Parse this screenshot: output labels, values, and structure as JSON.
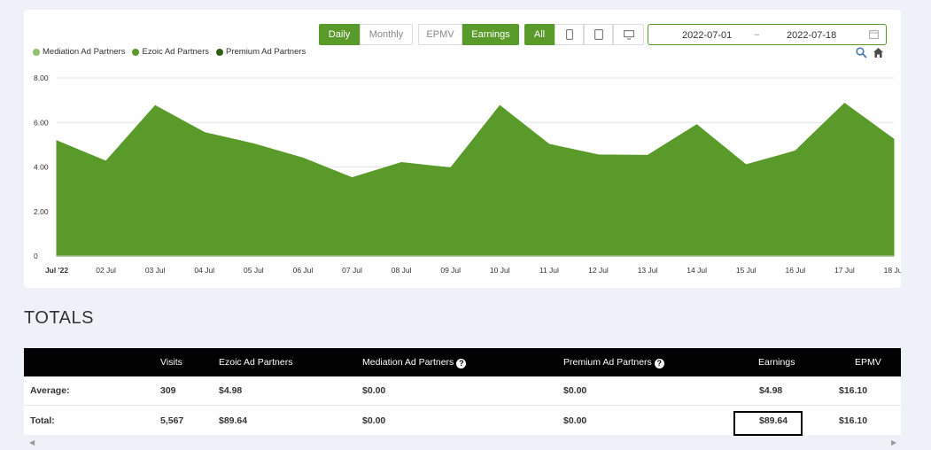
{
  "toolbar": {
    "period": [
      "Daily",
      "Monthly"
    ],
    "metric": [
      "EPMV",
      "Earnings"
    ],
    "device_all": "All"
  },
  "date_range": {
    "start": "2022-07-01",
    "separator": "~",
    "end": "2022-07-18"
  },
  "colors": {
    "accent": "#5a9a2b",
    "mediation": "#8dc26a",
    "ezoic": "#5a9a2b",
    "premium": "#2f5f14"
  },
  "chart_data": {
    "type": "area",
    "title": "",
    "xlabel": "",
    "ylabel": "",
    "legend": [
      "Mediation Ad Partners",
      "Ezoic Ad Partners",
      "Premium Ad Partners"
    ],
    "legend_position": "top-left",
    "categories": [
      "Jul '22",
      "02 Jul",
      "03 Jul",
      "04 Jul",
      "05 Jul",
      "06 Jul",
      "07 Jul",
      "08 Jul",
      "09 Jul",
      "10 Jul",
      "11 Jul",
      "12 Jul",
      "13 Jul",
      "14 Jul",
      "15 Jul",
      "16 Jul",
      "17 Jul",
      "18 Jul"
    ],
    "y_ticks": [
      "0",
      "2.00",
      "4.00",
      "6.00",
      "8.00"
    ],
    "ylim": [
      0,
      8
    ],
    "series": [
      {
        "name": "Ezoic Ad Partners",
        "values": [
          5.18,
          4.26,
          6.76,
          5.55,
          5.04,
          4.4,
          3.52,
          4.2,
          3.96,
          6.76,
          5.02,
          4.54,
          4.52,
          5.9,
          4.1,
          4.72,
          6.86,
          5.25
        ]
      }
    ]
  },
  "totals": {
    "title": "TOTALS",
    "headers": [
      "Visits",
      "Ezoic Ad Partners",
      "Mediation Ad Partners",
      "Premium Ad Partners",
      "Earnings",
      "EPMV"
    ],
    "rows": [
      {
        "label": "Average:",
        "visits": "309",
        "ezoic": "$4.98",
        "mediation": "$0.00",
        "premium": "$0.00",
        "earnings": "$4.98",
        "epmv": "$16.10"
      },
      {
        "label": "Total:",
        "visits": "5,567",
        "ezoic": "$89.64",
        "mediation": "$0.00",
        "premium": "$0.00",
        "earnings": "$89.64",
        "epmv": "$16.10"
      }
    ]
  }
}
